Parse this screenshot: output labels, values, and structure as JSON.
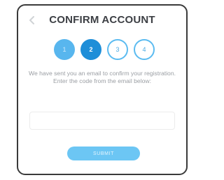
{
  "header": {
    "title": "CONFIRM ACCOUNT",
    "back_icon": "back-arrow-icon"
  },
  "steps": [
    {
      "label": "1",
      "state": "done"
    },
    {
      "label": "2",
      "state": "active"
    },
    {
      "label": "3",
      "state": "todo"
    },
    {
      "label": "4",
      "state": "todo"
    }
  ],
  "current_step": 2,
  "message": "We have sent you an email to confirm your registration. Enter the code from the email below:",
  "code_field": {
    "value": "",
    "placeholder": ""
  },
  "submit": {
    "label": "SUBMIT"
  },
  "colors": {
    "step_done": "#58b6ee",
    "step_active": "#1e8ed8",
    "step_outline": "#5bbbf0",
    "button": "#6cc6f4",
    "title": "#3c3f44",
    "text": "#9a9ea3"
  }
}
